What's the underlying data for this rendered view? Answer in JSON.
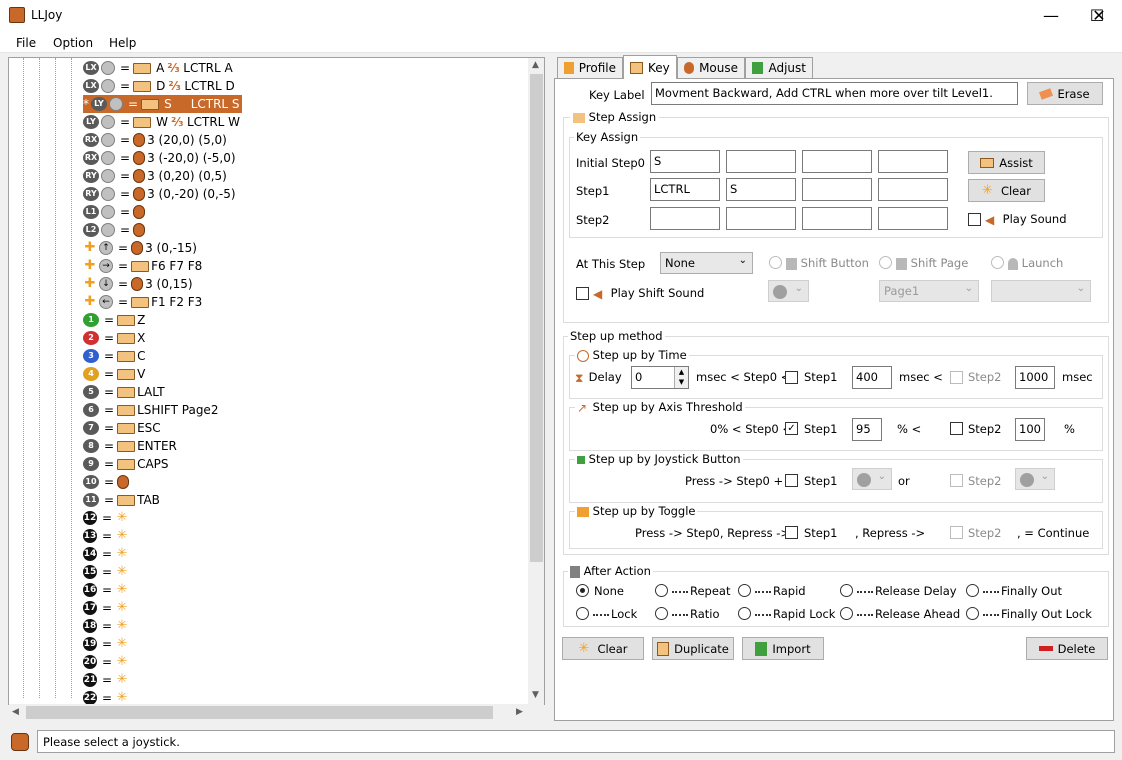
{
  "window": {
    "title": "LLJoy",
    "minimize": "—",
    "maximize": "☐",
    "close": "✕"
  },
  "menu": [
    "File",
    "Option",
    "Help"
  ],
  "tree": [
    {
      "badge": "LX",
      "mid": "A",
      "mod": "LCTRL A"
    },
    {
      "badge": "LX",
      "mid": "D",
      "mod": "LCTRL D"
    },
    {
      "badge": "LY",
      "mid": "S",
      "mod": "LCTRL S",
      "selected": true,
      "prefix": "*"
    },
    {
      "badge": "LY",
      "mid": "W",
      "mod": "LCTRL W"
    },
    {
      "badge": "RX",
      "text": "3 (20,0)  (5,0)"
    },
    {
      "badge": "RX",
      "text": "3 (-20,0)  (-5,0)"
    },
    {
      "badge": "RY",
      "text": "3 (0,20)  (0,5)"
    },
    {
      "badge": "RY",
      "text": "3 (0,-20)  (0,-5)"
    },
    {
      "badge": "L1",
      "text": ""
    },
    {
      "badge": "L2",
      "text": ""
    },
    {
      "badge": "↑",
      "text": "3 (0,-15)"
    },
    {
      "badge": "→",
      "text": "F6 F7 F8"
    },
    {
      "badge": "↓",
      "text": "3 (0,15)"
    },
    {
      "badge": "←",
      "text": "F1 F2 F3"
    },
    {
      "badge": "1",
      "text": "Z"
    },
    {
      "badge": "2",
      "text": "X"
    },
    {
      "badge": "3",
      "text": "C"
    },
    {
      "badge": "4",
      "text": "V"
    },
    {
      "badge": "5",
      "text": "LALT"
    },
    {
      "badge": "6",
      "text": "LSHIFT   Page2"
    },
    {
      "badge": "7",
      "text": "ESC"
    },
    {
      "badge": "8",
      "text": "ENTER"
    },
    {
      "badge": "9",
      "text": "CAPS"
    },
    {
      "badge": "10",
      "text": ""
    },
    {
      "badge": "11",
      "text": "TAB"
    },
    {
      "badge": "12",
      "text": ""
    },
    {
      "badge": "13",
      "text": ""
    },
    {
      "badge": "14",
      "text": ""
    },
    {
      "badge": "15",
      "text": ""
    },
    {
      "badge": "16",
      "text": ""
    },
    {
      "badge": "17",
      "text": ""
    },
    {
      "badge": "18",
      "text": ""
    },
    {
      "badge": "19",
      "text": ""
    },
    {
      "badge": "20",
      "text": ""
    },
    {
      "badge": "21",
      "text": ""
    },
    {
      "badge": "22",
      "text": ""
    }
  ],
  "tabs": [
    "Profile",
    "Key",
    "Mouse",
    "Adjust"
  ],
  "key_label": {
    "label": "Key Label",
    "value": "Movment Backward, Add CTRL when more over tilt Level1.",
    "erase": "Erase"
  },
  "step_assign": {
    "title": "Step Assign",
    "key_assign": "Key Assign",
    "rows": [
      {
        "label": "Initial Step0",
        "cells": [
          "S",
          "",
          "",
          ""
        ]
      },
      {
        "label": "Step1",
        "cells": [
          "LCTRL",
          "S",
          "",
          ""
        ]
      },
      {
        "label": "Step2",
        "cells": [
          "",
          "",
          "",
          ""
        ]
      }
    ],
    "assign": "Assist",
    "clear": "Clear",
    "play_sound": "Play Sound",
    "at_this_step": "At This Step",
    "at_this_step_value": "None",
    "shift_button": "Shift Button",
    "shift_page": "Shift Page",
    "launch": "Launch",
    "play_shift_sound": "Play Shift Sound",
    "page_value": "Page1"
  },
  "step_up": {
    "title": "Step up method",
    "time": {
      "title": "Step up by Time",
      "delay": "Delay",
      "delay_value": "0",
      "msec_lt": "msec < Step0 <",
      "step1": "Step1",
      "v1": "400",
      "msec2": "msec <",
      "step2": "Step2",
      "v2": "1000",
      "msec3": "msec"
    },
    "axis": {
      "title": "Step up by Axis Threshold",
      "pre": "0% < Step0 <",
      "step1": "Step1",
      "v1": "95",
      "pct": "% <",
      "step2": "Step2",
      "v2": "100",
      "pct2": "%"
    },
    "button": {
      "title": "Step up by Joystick Button",
      "pre": "Press -> Step0 +",
      "step1": "Step1",
      "or": "or",
      "step2": "Step2"
    },
    "toggle": {
      "title": "Step up by Toggle",
      "pre": "Press -> Step0, Repress ->",
      "step1": "Step1",
      "mid": ", Repress ->",
      "step2": "Step2",
      "post": ", = Continue"
    }
  },
  "after_action": {
    "title": "After Action",
    "options": [
      "None",
      "Repeat",
      "Rapid",
      "Release Delay",
      "Finally Out",
      "Lock",
      "Ratio",
      "Rapid Lock",
      "Release Ahead",
      "Finally Out Lock"
    ],
    "selected": "None"
  },
  "bottom_buttons": {
    "clear": "Clear",
    "duplicate": "Duplicate",
    "import": "Import",
    "delete": "Delete"
  },
  "status": "Please select a joystick.",
  "colors": {
    "accent": "#c8692a",
    "selection": "#c8692a"
  }
}
